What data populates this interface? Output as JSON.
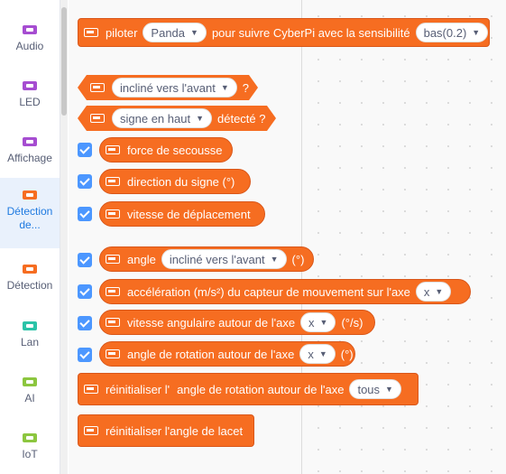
{
  "categories": [
    {
      "label": "Audio",
      "color": "#a64dd1"
    },
    {
      "label": "LED",
      "color": "#a64dd1"
    },
    {
      "label": "Affichage",
      "color": "#a64dd1"
    },
    {
      "label": "Détection de...",
      "color": "#f66d21",
      "active": true
    },
    {
      "label": "Détection",
      "color": "#f66d21"
    },
    {
      "label": "Lan",
      "color": "#2bc3a8"
    },
    {
      "label": "AI",
      "color": "#8cc63f"
    },
    {
      "label": "IoT",
      "color": "#8cc63f"
    }
  ],
  "blocks": {
    "pilot": {
      "pre": "piloter",
      "opt": "Panda",
      "mid": "pour suivre CyberPi avec la sensibilité",
      "opt2": "bas(0.2)"
    },
    "tilt": {
      "opt": "incliné vers l'avant",
      "post": "?"
    },
    "sign": {
      "opt": "signe en haut",
      "post": "détecté ?"
    },
    "shake": {
      "label": "force de secousse"
    },
    "direction": {
      "label": "direction du signe (°)"
    },
    "speed": {
      "label": "vitesse de déplacement"
    },
    "angle": {
      "pre": "angle",
      "opt": "incliné vers l'avant",
      "post": "(°)"
    },
    "accel": {
      "pre": "accélération (m/s²) du capteur de mouvement sur l'axe",
      "opt": "x"
    },
    "gyro": {
      "pre": "vitesse angulaire autour de l'axe",
      "opt": "x",
      "post": "(°/s)"
    },
    "rot": {
      "pre": "angle de rotation autour de l'axe",
      "opt": "x",
      "post": "(°)"
    },
    "reset": {
      "pre": "réinitialiser l'",
      "mid": "angle de rotation autour de l'axe",
      "opt": "tous"
    },
    "yaw": {
      "label": "réinitialiser l'angle de lacet"
    }
  },
  "colors": {
    "sensing": "#f66d21",
    "checkbox": "#4c97ff",
    "active_text": "#1f7ae0"
  }
}
